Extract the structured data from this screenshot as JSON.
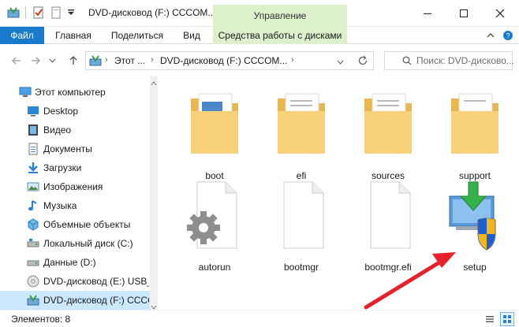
{
  "window": {
    "title": "DVD-дисковод (F:) CCCOM...",
    "context_tab_group": "Управление"
  },
  "ribbon": {
    "tabs": [
      {
        "label": "Файл"
      },
      {
        "label": "Главная"
      },
      {
        "label": "Поделиться"
      },
      {
        "label": "Вид"
      },
      {
        "label": "Средства работы с дисками"
      }
    ]
  },
  "address": {
    "crumbs": [
      "Этот ...",
      "DVD-дисковод (F:) CCCOM..."
    ],
    "search_placeholder": "Поиск: DVD-дисково..."
  },
  "sidebar": {
    "items": [
      {
        "label": "Этот компьютер",
        "icon": "computer-icon"
      },
      {
        "label": "Desktop",
        "icon": "desktop-icon"
      },
      {
        "label": "Видео",
        "icon": "video-icon"
      },
      {
        "label": "Документы",
        "icon": "documents-icon"
      },
      {
        "label": "Загрузки",
        "icon": "downloads-icon"
      },
      {
        "label": "Изображения",
        "icon": "pictures-icon"
      },
      {
        "label": "Музыка",
        "icon": "music-icon"
      },
      {
        "label": "Объемные объекты",
        "icon": "3d-objects-icon"
      },
      {
        "label": "Локальный диск (C:)",
        "icon": "drive-icon"
      },
      {
        "label": "Данные (D:)",
        "icon": "drive-icon"
      },
      {
        "label": "DVD-дисковод (E:) USB_",
        "icon": "dvd-icon"
      },
      {
        "label": "DVD-дисковод (F:) CCCO",
        "icon": "dvd-drive-icon"
      }
    ]
  },
  "files": [
    {
      "name": "boot",
      "type": "folder"
    },
    {
      "name": "efi",
      "type": "folder"
    },
    {
      "name": "sources",
      "type": "folder"
    },
    {
      "name": "support",
      "type": "folder"
    },
    {
      "name": "autorun",
      "type": "settings-file"
    },
    {
      "name": "bootmgr",
      "type": "file"
    },
    {
      "name": "bootmgr.efi",
      "type": "file"
    },
    {
      "name": "setup",
      "type": "setup-exe"
    }
  ],
  "status": {
    "item_count": "Элементов: 8"
  },
  "colors": {
    "accent": "#1979ca",
    "context_tab": "#dcf0cb",
    "selection": "#cce8ff",
    "annotation_arrow": "#e8202a",
    "folder": "#f5c96a"
  }
}
